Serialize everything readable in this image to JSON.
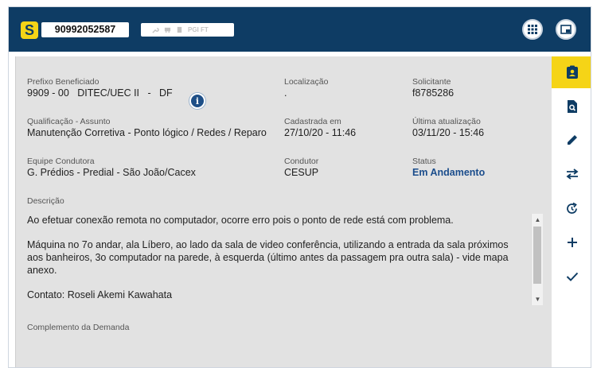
{
  "header": {
    "logo_letter": "S",
    "ticket_id": "90992052587",
    "toolbar_text": "PGI FT",
    "icons": [
      "wrench-icon",
      "truck-icon",
      "document-icon"
    ]
  },
  "fields": {
    "prefixo_label": "Prefixo Beneficiado",
    "prefixo_value": "9909 - 00   DITEC/UEC II   -   DF",
    "localizacao_label": "Localização",
    "localizacao_value": ".",
    "solicitante_label": "Solicitante",
    "solicitante_value": "f8785286",
    "qualificacao_label": "Qualificação - Assunto",
    "qualificacao_value": "Manutenção Corretiva - Ponto lógico / Redes / Reparo",
    "cadastrada_label": "Cadastrada em",
    "cadastrada_value": "27/10/20 - 11:46",
    "ultima_label": "Última atualização",
    "ultima_value": "03/11/20 - 15:46",
    "equipe_label": "Equipe Condutora",
    "equipe_value": "G. Prédios - Predial - São João/Cacex",
    "condutor_label": "Condutor",
    "condutor_value": "CESUP",
    "status_label": "Status",
    "status_value": "Em Andamento",
    "descricao_label": "Descrição",
    "descricao_p1": "Ao efetuar conexão remota no computador, ocorre erro pois o ponto de rede está com problema.",
    "descricao_p2": "Máquina no 7o andar, ala Líbero, ao lado da sala de video conferência, utilizando a entrada da sala próximos aos banheiros, 3o computador na parede, à esquerda (último antes da passagem pra outra sala)  - vide mapa anexo.",
    "descricao_p3": "Contato: Roseli Akemi Kawahata",
    "complemento_label": "Complemento da Demanda"
  },
  "sidebar": {
    "actions": [
      "clipboard-user-icon",
      "search-document-icon",
      "edit-pencil-icon",
      "transfer-arrows-icon",
      "history-refresh-icon",
      "add-plus-icon",
      "check-icon"
    ],
    "active_index": 0
  },
  "colors": {
    "header_bg": "#0e3c64",
    "accent_yellow": "#f5d417",
    "status_blue": "#1b4d8c"
  }
}
